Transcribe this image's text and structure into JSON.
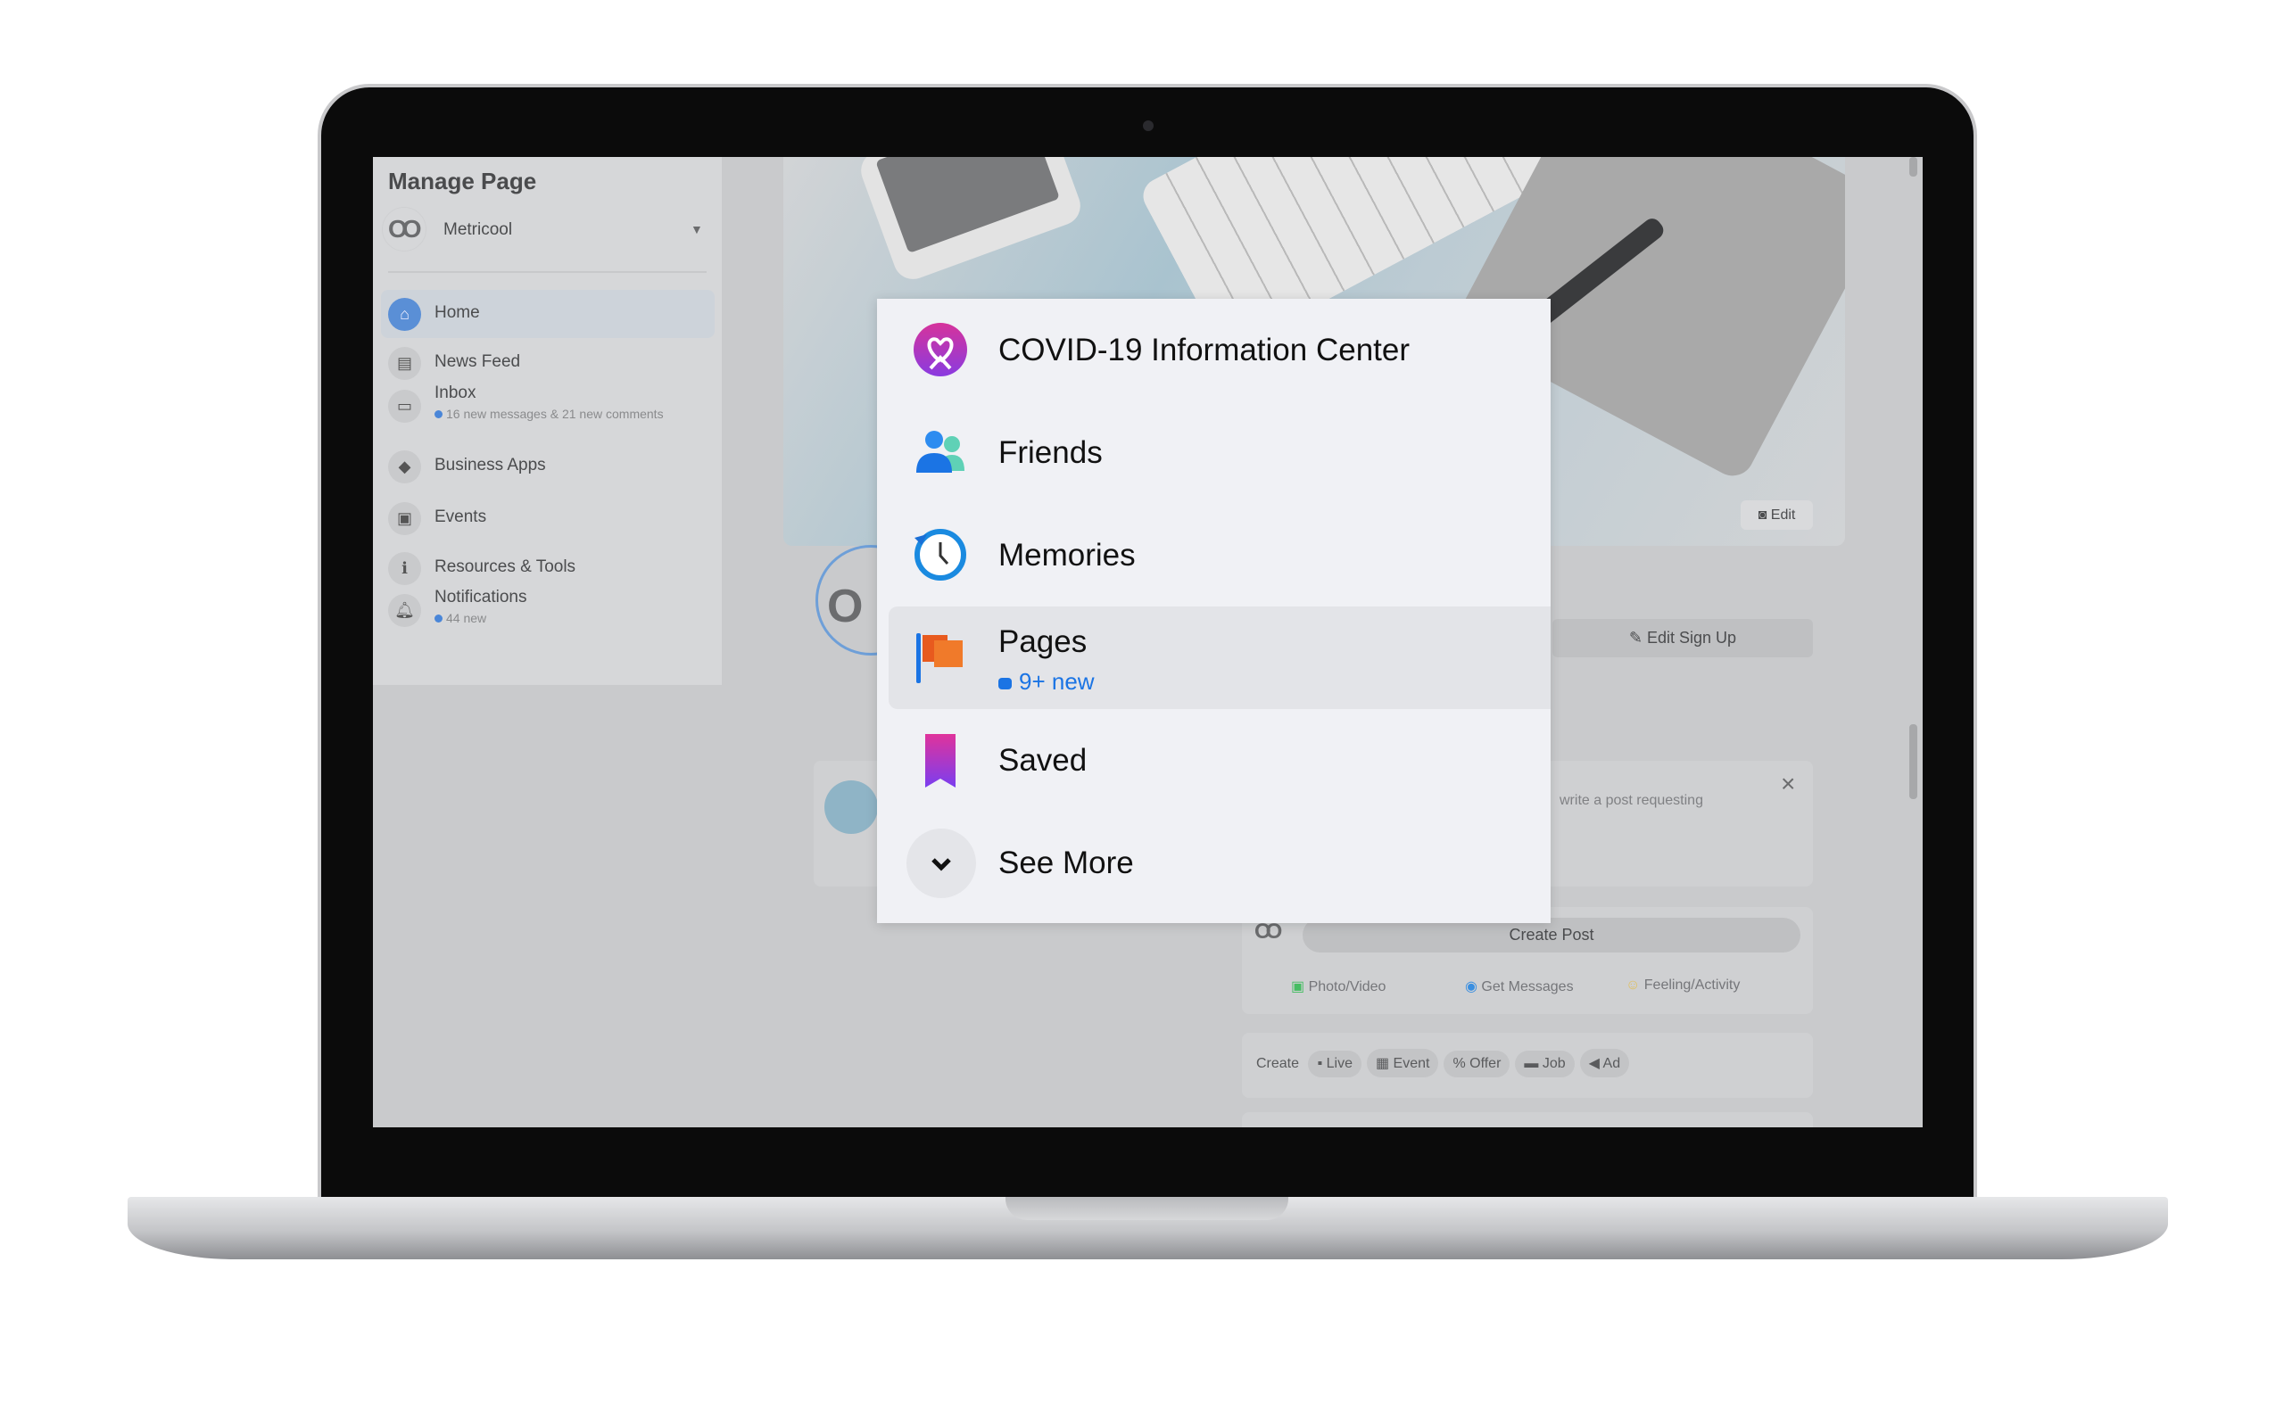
{
  "sidebar": {
    "title": "Manage Page",
    "page_name": "Metricool",
    "items": [
      {
        "label": "Home",
        "icon": "home-icon",
        "active": true
      },
      {
        "label": "News Feed",
        "icon": "news-feed-icon"
      },
      {
        "label": "Inbox",
        "icon": "inbox-icon",
        "sub": "16 new messages & 21 new comments"
      },
      {
        "label": "Business Apps",
        "icon": "cube-icon"
      },
      {
        "label": "Events",
        "icon": "calendar-star-icon"
      },
      {
        "label": "Resources & Tools",
        "icon": "info-icon"
      },
      {
        "label": "Notifications",
        "icon": "bell-icon",
        "sub": "44 new"
      }
    ]
  },
  "cover": {
    "edit_label": "Edit"
  },
  "profile": {
    "edit_signup_label": "Edit Sign Up"
  },
  "prompt_card": {
    "text": "write a post requesting"
  },
  "create_post": {
    "button_label": "Create Post",
    "actions": [
      "Photo/Video",
      "Get Messages",
      "Feeling/Activity"
    ]
  },
  "create_row": {
    "label": "Create",
    "chips": [
      "Live",
      "Event",
      "Offer",
      "Job",
      "Ad"
    ]
  },
  "menu": {
    "items": [
      {
        "label": "COVID-19 Information Center",
        "icon": "covid-heart-icon"
      },
      {
        "label": "Friends",
        "icon": "friends-icon"
      },
      {
        "label": "Memories",
        "icon": "memories-clock-icon"
      },
      {
        "label": "Pages",
        "icon": "pages-flag-icon",
        "sub": "9+ new",
        "highlighted": true
      },
      {
        "label": "Saved",
        "icon": "saved-bookmark-icon"
      },
      {
        "label": "See More",
        "icon": "chevron-down-icon"
      }
    ],
    "accent": "#1b74e4"
  }
}
